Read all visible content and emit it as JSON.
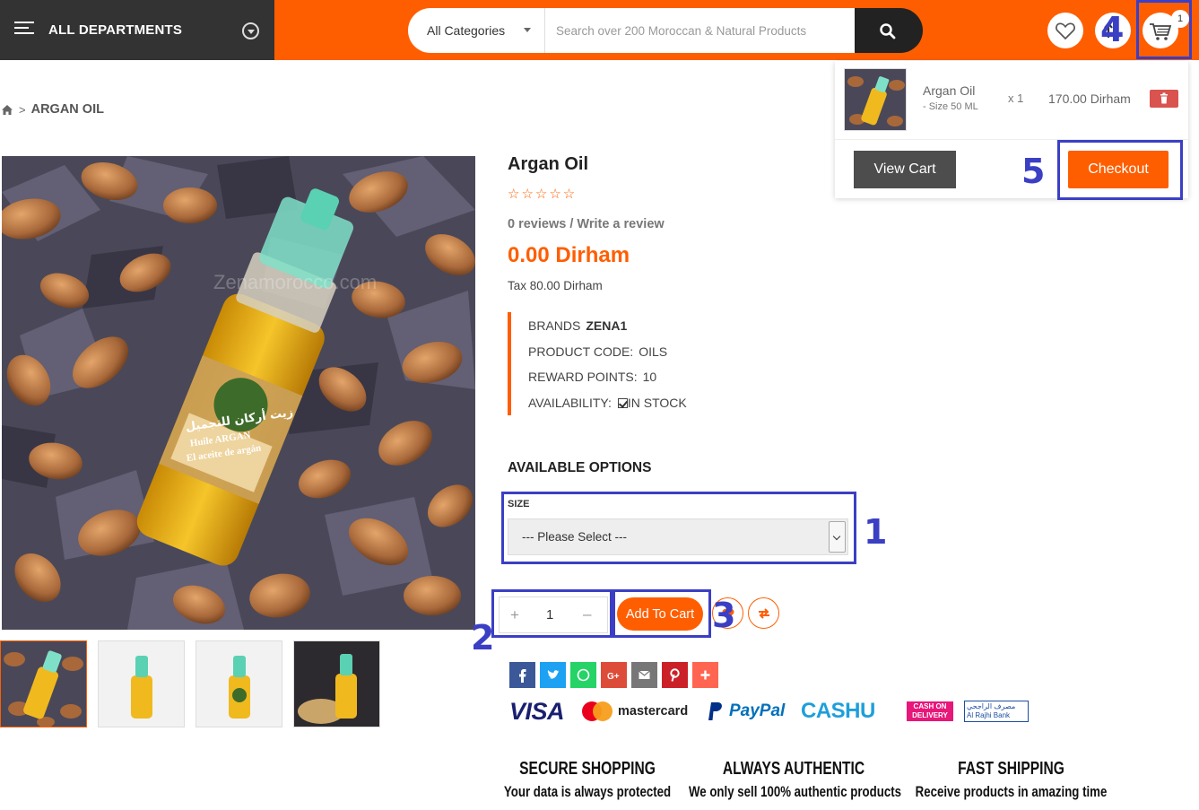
{
  "header": {
    "departments_label": "ALL DEPARTMENTS",
    "search": {
      "category": "All Categories",
      "placeholder": "Search over 200 Moroccan & Natural Products"
    },
    "cart_count": "1"
  },
  "breadcrumb": {
    "current": "ARGAN OIL"
  },
  "product": {
    "title": "Argan Oil",
    "rating_stars": "☆☆☆☆☆",
    "reviews_text": "0 reviews",
    "reviews_sep": " / ",
    "write_review": "Write a review",
    "price": "0.00 Dirham",
    "tax": "Tax 80.00 Dirham",
    "specs": [
      {
        "label": "BRANDS",
        "value": "ZENA1"
      },
      {
        "label": "PRODUCT CODE:",
        "value": "OILS"
      },
      {
        "label": "REWARD POINTS:",
        "value": "10"
      },
      {
        "label": "AVAILABILITY:",
        "value": "IN STOCK"
      }
    ],
    "image_watermark": "Zenamorocco.com",
    "bottle_label_ar": "زيت أركان للتجميل",
    "bottle_label_fr": "Huile ARGAN",
    "bottle_label_es": "El aceite de argán"
  },
  "options": {
    "heading": "AVAILABLE OPTIONS",
    "size_label": "SIZE",
    "size_selected": "--- Please Select ---"
  },
  "purchase": {
    "quantity": "1",
    "plus": "+",
    "minus": "–",
    "add_to_cart": "Add To Cart"
  },
  "payments": {
    "visa": "VISA",
    "mastercard": "mastercard",
    "paypal": "PayPal",
    "cashu": "CASHU",
    "cod_line1": "CASH ON",
    "cod_line2": "DELIVERY",
    "rajhi_ar": "مصرف الراجحي",
    "rajhi": "Al Rajhi Bank"
  },
  "features": [
    {
      "title": "SECURE SHOPPING",
      "subtitle": "Your data is always protected"
    },
    {
      "title": "ALWAYS AUTHENTIC",
      "subtitle": "We only sell 100% authentic products"
    },
    {
      "title": "FAST SHIPPING",
      "subtitle": "Receive products in amazing time"
    }
  ],
  "cart_dropdown": {
    "item_name": "Argan Oil",
    "item_option": "- Size 50 ML",
    "item_qty": "x 1",
    "item_price": "170.00 Dirham",
    "view_cart": "View Cart",
    "checkout": "Checkout"
  },
  "annotations": [
    "1",
    "2",
    "3",
    "4",
    "5"
  ],
  "colors": {
    "brand_orange": "#ff5e00",
    "dark": "#333333",
    "annotation_blue": "#3b3fc4",
    "delete_red": "#d9534f"
  }
}
